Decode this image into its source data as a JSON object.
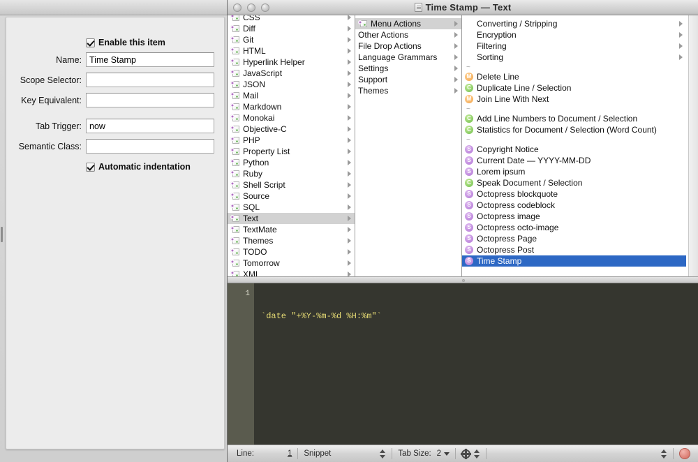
{
  "window": {
    "title": "Time Stamp — Text",
    "title_icon": "document-icon",
    "traffic_lights": [
      "close-button",
      "minimize-button",
      "zoom-button"
    ]
  },
  "inspector": {
    "enable_checkbox": {
      "label": "Enable this item",
      "checked": true
    },
    "fields": [
      {
        "label": "Name:",
        "value": "Time Stamp",
        "placeholder": ""
      },
      {
        "label": "Scope Selector:",
        "value": "",
        "placeholder": ""
      },
      {
        "label": "Key Equivalent:",
        "value": "",
        "placeholder": ""
      },
      {
        "label": "Tab Trigger:",
        "value": "now",
        "placeholder": ""
      },
      {
        "label": "Semantic Class:",
        "value": "",
        "placeholder": ""
      }
    ],
    "auto_indent_checkbox": {
      "label": "Automatic indentation",
      "checked": true
    }
  },
  "browser": {
    "column1": {
      "items": [
        {
          "label": "CSS",
          "icon": "bundle-icon",
          "has_children": true,
          "selected": false,
          "clipped_top": true
        },
        {
          "label": "Diff",
          "icon": "bundle-icon",
          "has_children": true,
          "selected": false
        },
        {
          "label": "Git",
          "icon": "bundle-icon",
          "has_children": true,
          "selected": false
        },
        {
          "label": "HTML",
          "icon": "bundle-icon",
          "has_children": true,
          "selected": false
        },
        {
          "label": "Hyperlink Helper",
          "icon": "bundle-icon",
          "has_children": true,
          "selected": false
        },
        {
          "label": "JavaScript",
          "icon": "bundle-icon",
          "has_children": true,
          "selected": false
        },
        {
          "label": "JSON",
          "icon": "bundle-icon",
          "has_children": true,
          "selected": false
        },
        {
          "label": "Mail",
          "icon": "bundle-icon",
          "has_children": true,
          "selected": false
        },
        {
          "label": "Markdown",
          "icon": "bundle-icon",
          "has_children": true,
          "selected": false
        },
        {
          "label": "Monokai",
          "icon": "bundle-icon",
          "has_children": true,
          "selected": false
        },
        {
          "label": "Objective-C",
          "icon": "bundle-icon",
          "has_children": true,
          "selected": false
        },
        {
          "label": "PHP",
          "icon": "bundle-icon",
          "has_children": true,
          "selected": false
        },
        {
          "label": "Property List",
          "icon": "bundle-icon",
          "has_children": true,
          "selected": false
        },
        {
          "label": "Python",
          "icon": "bundle-icon",
          "has_children": true,
          "selected": false
        },
        {
          "label": "Ruby",
          "icon": "bundle-icon",
          "has_children": true,
          "selected": false
        },
        {
          "label": "Shell Script",
          "icon": "bundle-icon",
          "has_children": true,
          "selected": false
        },
        {
          "label": "Source",
          "icon": "bundle-icon",
          "has_children": true,
          "selected": false
        },
        {
          "label": "SQL",
          "icon": "bundle-icon",
          "has_children": true,
          "selected": false
        },
        {
          "label": "Text",
          "icon": "bundle-icon",
          "has_children": true,
          "selected": true
        },
        {
          "label": "TextMate",
          "icon": "bundle-icon",
          "has_children": true,
          "selected": false
        },
        {
          "label": "Themes",
          "icon": "bundle-icon",
          "has_children": true,
          "selected": false
        },
        {
          "label": "TODO",
          "icon": "bundle-icon",
          "has_children": true,
          "selected": false
        },
        {
          "label": "Tomorrow",
          "icon": "bundle-icon",
          "has_children": true,
          "selected": false
        },
        {
          "label": "XML",
          "icon": "bundle-icon",
          "has_children": true,
          "selected": false,
          "clipped_bottom": true
        }
      ]
    },
    "column2": {
      "items": [
        {
          "label": "Menu Actions",
          "icon": "bundle-icon",
          "has_children": true,
          "selected": true
        },
        {
          "label": "Other Actions",
          "icon": null,
          "has_children": true,
          "selected": false
        },
        {
          "label": "File Drop Actions",
          "icon": null,
          "has_children": true,
          "selected": false
        },
        {
          "label": "Language Grammars",
          "icon": null,
          "has_children": true,
          "selected": false
        },
        {
          "label": "Settings",
          "icon": null,
          "has_children": true,
          "selected": false
        },
        {
          "label": "Support",
          "icon": null,
          "has_children": true,
          "selected": false
        },
        {
          "label": "Themes",
          "icon": null,
          "has_children": true,
          "selected": false
        }
      ]
    },
    "column3": {
      "items": [
        {
          "label": "Converting / Stripping",
          "type": "group",
          "has_children": true,
          "selected": false
        },
        {
          "label": "Encryption",
          "type": "group",
          "has_children": true,
          "selected": false
        },
        {
          "label": "Filtering",
          "type": "group",
          "has_children": true,
          "selected": false
        },
        {
          "label": "Sorting",
          "type": "group",
          "has_children": true,
          "selected": false
        },
        {
          "label": "~",
          "type": "separator"
        },
        {
          "label": "Delete Line",
          "type": "macro",
          "badge": "M",
          "selected": false
        },
        {
          "label": "Duplicate Line / Selection",
          "type": "command",
          "badge": "C",
          "selected": false
        },
        {
          "label": "Join Line With Next",
          "type": "macro",
          "badge": "M",
          "selected": false
        },
        {
          "label": "~",
          "type": "separator"
        },
        {
          "label": "Add Line Numbers to Document / Selection",
          "type": "command",
          "badge": "C",
          "selected": false
        },
        {
          "label": "Statistics for Document / Selection (Word Count)",
          "type": "command",
          "badge": "C",
          "selected": false
        },
        {
          "label": "~",
          "type": "separator"
        },
        {
          "label": "Copyright Notice",
          "type": "snippet",
          "badge": "S",
          "selected": false
        },
        {
          "label": "Current Date — YYYY-MM-DD",
          "type": "snippet",
          "badge": "S",
          "selected": false
        },
        {
          "label": "Lorem ipsum",
          "type": "snippet",
          "badge": "S",
          "selected": false
        },
        {
          "label": "Speak Document / Selection",
          "type": "command",
          "badge": "C",
          "selected": false
        },
        {
          "label": "Octopress blockquote",
          "type": "snippet",
          "badge": "S",
          "selected": false
        },
        {
          "label": "Octopress codeblock",
          "type": "snippet",
          "badge": "S",
          "selected": false
        },
        {
          "label": "Octopress image",
          "type": "snippet",
          "badge": "S",
          "selected": false
        },
        {
          "label": "Octopress octo-image",
          "type": "snippet",
          "badge": "S",
          "selected": false
        },
        {
          "label": "Octopress Page",
          "type": "snippet",
          "badge": "S",
          "selected": false
        },
        {
          "label": "Octopress Post",
          "type": "snippet",
          "badge": "S",
          "selected": false
        },
        {
          "label": "Time Stamp",
          "type": "snippet",
          "badge": "S",
          "selected": true
        }
      ]
    }
  },
  "editor": {
    "line_numbers": [
      "1"
    ],
    "lines": [
      "`date \"+%Y-%m-%d %H:%m\"`"
    ]
  },
  "statusbar": {
    "line_label": "Line:",
    "line_value": "1",
    "item_type": "Snippet",
    "tab_size_label": "Tab Size:",
    "tab_size_value": "2",
    "gear_icon": "gear-icon",
    "record_icon": "record-button"
  },
  "colors": {
    "selection_blue": "#2d68c4",
    "selection_gray": "#d2d2d2",
    "editor_bg": "#35362f",
    "editor_gutter": "#5a5b4e",
    "code_yellow": "#e6db74",
    "macro_orange": "#f3a54a",
    "command_green": "#6fbf4a",
    "snippet_purple": "#b377d6"
  }
}
